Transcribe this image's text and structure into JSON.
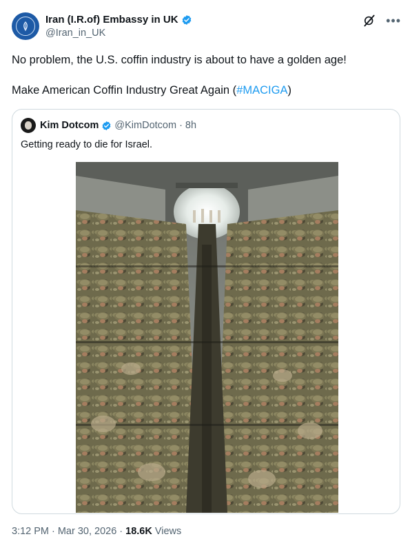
{
  "author": {
    "display_name": "Iran (I.R.of) Embassy in UK",
    "handle": "@Iran_in_UK",
    "avatar_icon": "embassy-emblem-icon",
    "verified_color": "#1d9bf0"
  },
  "tweet": {
    "line1": "No problem, the U.S. coffin industry is about to have a golden age!",
    "line2_prefix": "Make American Coffin Industry Great Again (",
    "hashtag": "#MACIGA",
    "line2_suffix": ")"
  },
  "quote": {
    "display_name": "Kim Dotcom",
    "handle": "@KimDotcom",
    "separator": "·",
    "time": "8h",
    "text": "Getting ready to die for Israel."
  },
  "footer": {
    "time": "3:12 PM",
    "sep1": "·",
    "date": "Mar 30, 2026",
    "sep2": "·",
    "views_count": "18.6K",
    "views_label": "Views"
  },
  "colors": {
    "accent": "#1d9bf0",
    "text": "#0f1419",
    "muted": "#536471",
    "border": "#cfd9de"
  }
}
